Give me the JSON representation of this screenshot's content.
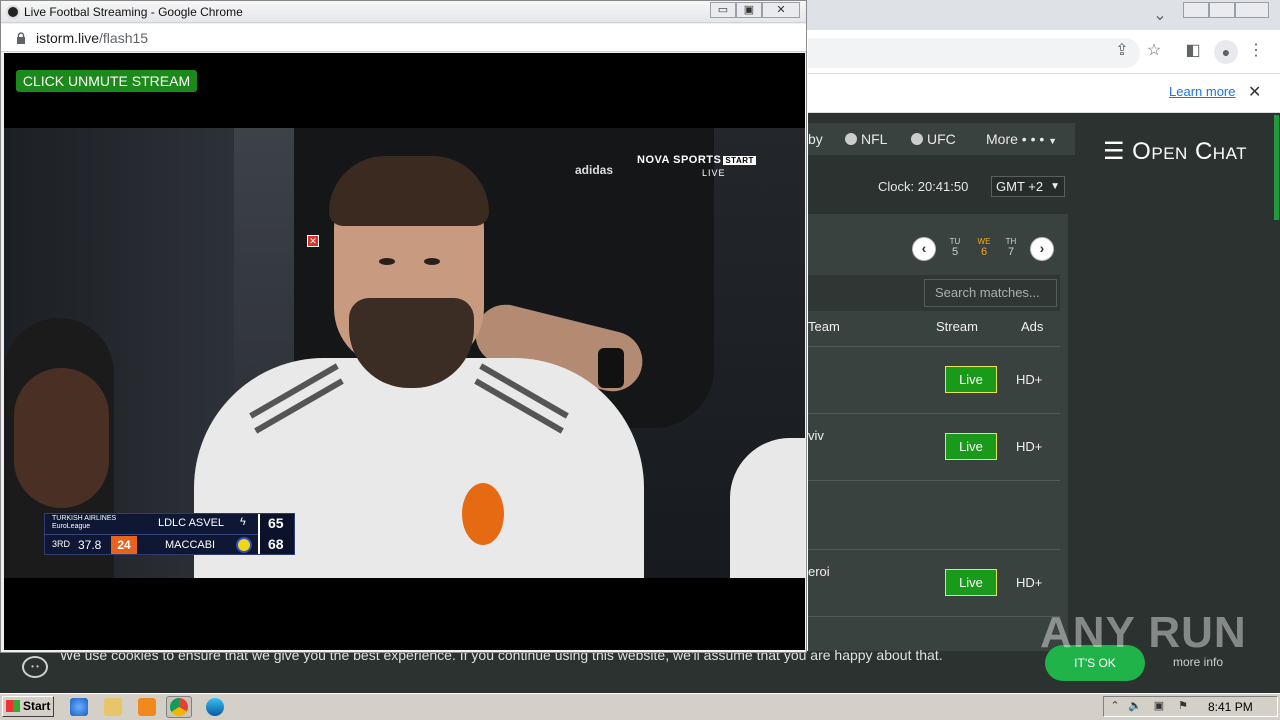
{
  "popup": {
    "title": "Live Footbal Streaming - Google Chrome",
    "url_host": "istorm.live",
    "url_path": "/flash15",
    "unmute_label": "CLICK UNMUTE STREAM",
    "minimize": "▭",
    "maximize": "▣",
    "close": "✕"
  },
  "video": {
    "broadcaster": "NOVA SPORTS",
    "broadcaster_tag": "START",
    "broadcaster_live": "LIVE",
    "brand": "adidas",
    "scoreboard": {
      "league_line1": "TURKISH AIRLINES",
      "league_line2": "EuroLeague",
      "team1": "LDLC ASVEL",
      "team2": "MACCABI",
      "score1": "65",
      "score2": "68",
      "quarter": "3RD",
      "clock": "37.8",
      "shot_clock": "24"
    }
  },
  "background_window": {
    "infobar_link": "Learn more",
    "nav": [
      {
        "label": "by"
      },
      {
        "label": "NFL"
      },
      {
        "label": "UFC"
      },
      {
        "label": "More • • •"
      }
    ],
    "open_chat": "☰ Open Chat",
    "clock": "Clock: 20:41:50",
    "timezone": "GMT +2",
    "days": [
      {
        "dow": "TU",
        "num": "5",
        "active": false
      },
      {
        "dow": "WE",
        "num": "6",
        "active": true
      },
      {
        "dow": "TH",
        "num": "7",
        "active": false
      }
    ],
    "search_placeholder": "Search matches...",
    "columns": {
      "team": "Team",
      "stream": "Stream",
      "ads": "Ads"
    },
    "rows": [
      {
        "team": "",
        "stream": "Live",
        "ads": "HD+"
      },
      {
        "team": "viv",
        "stream": "Live",
        "ads": "HD+"
      },
      {
        "team": "",
        "stream": "",
        "ads": ""
      },
      {
        "team": "eroi",
        "stream": "Live",
        "ads": "HD+"
      }
    ]
  },
  "cookie": {
    "text": "We use cookies to ensure that we give you the best experience. If you continue using this website, we'll assume that you are happy about that.",
    "ok": "IT'S OK",
    "more_info": "more info"
  },
  "watermark": "ANY RUN",
  "taskbar": {
    "start": "Start",
    "time": "8:41 PM"
  },
  "colors": {
    "live_green": "#1a9a1a",
    "accent_green": "#1fb34a",
    "active_day": "#f5a623"
  }
}
